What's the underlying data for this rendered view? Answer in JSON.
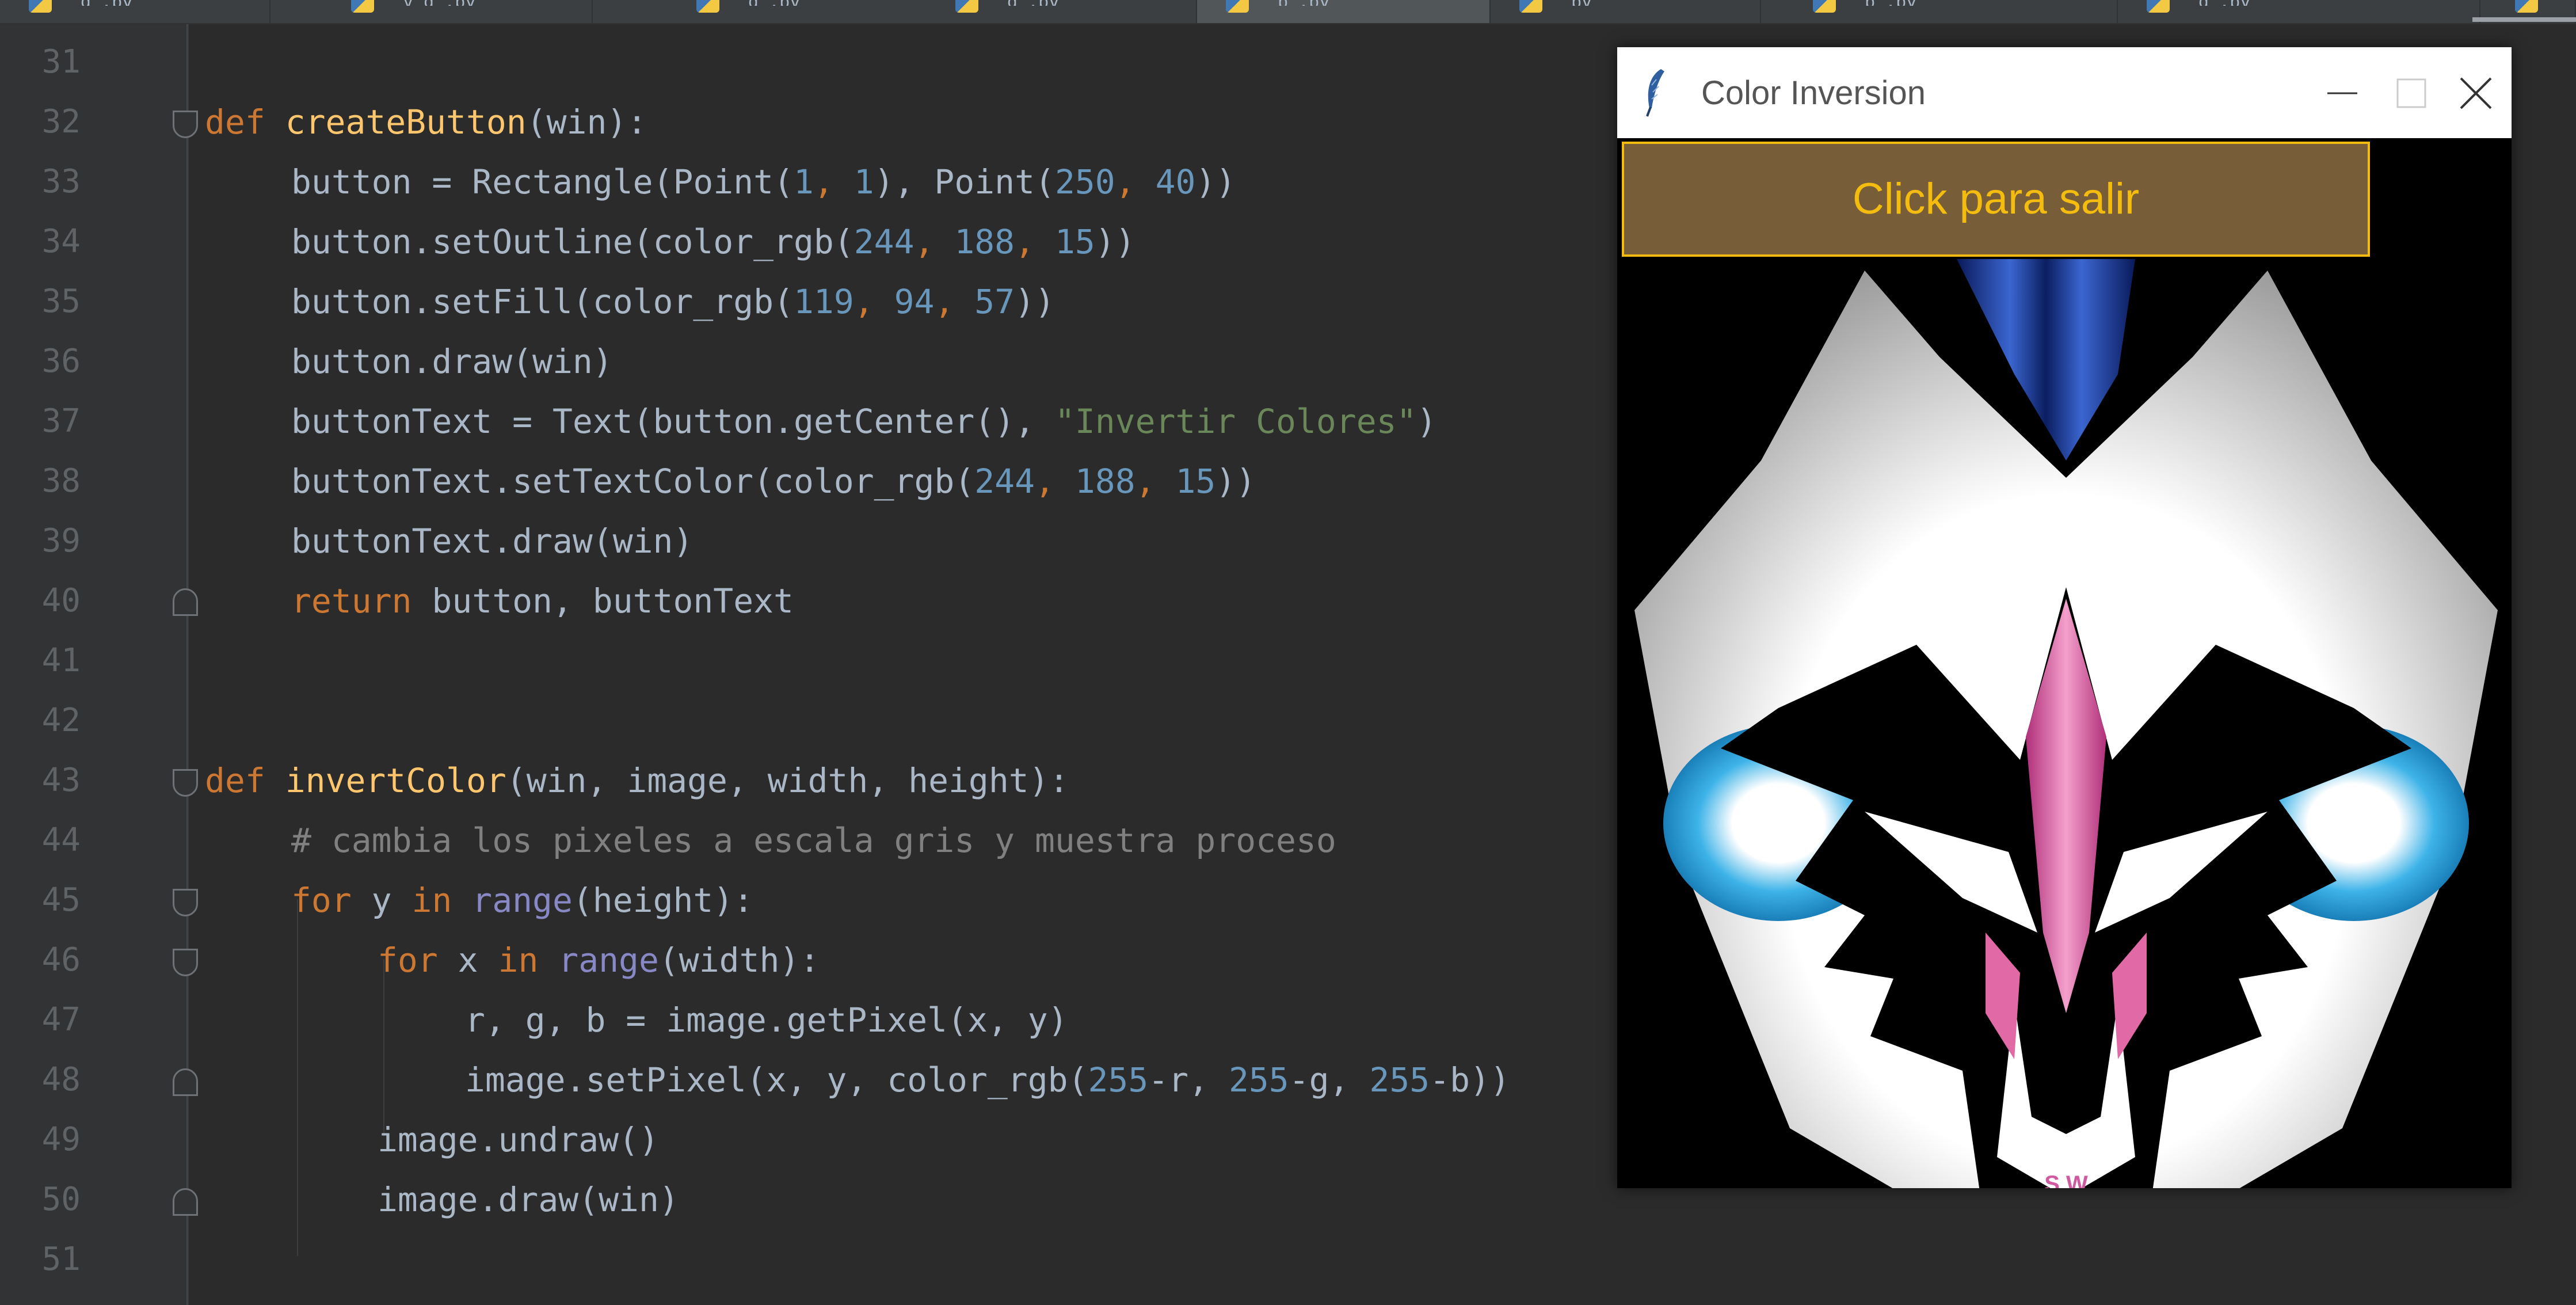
{
  "tabs": [
    {
      "label": "g .py"
    },
    {
      "label": "y g .py"
    },
    {
      "label": "g .py"
    },
    {
      "label": "g .py"
    },
    {
      "label": "p .py",
      "active": true
    },
    {
      "label": "py"
    },
    {
      "label": "p .py"
    },
    {
      "label": "g .py"
    }
  ],
  "line_numbers": [
    "31",
    "32",
    "33",
    "34",
    "35",
    "36",
    "37",
    "38",
    "39",
    "40",
    "41",
    "42",
    "43",
    "44",
    "45",
    "46",
    "47",
    "48",
    "49",
    "50",
    "51"
  ],
  "code": {
    "l32": {
      "kw": "def",
      "name": "createButton",
      "rest": "(win):"
    },
    "l33": {
      "a": "button = Rectangle(Point(",
      "n1": "1",
      "c1": ", ",
      "n2": "1",
      "b": "), Point(",
      "n3": "250",
      "c2": ", ",
      "n4": "40",
      "e": "))"
    },
    "l34": {
      "a": "button.setOutline(color_rgb(",
      "n1": "244",
      "c1": ", ",
      "n2": "188",
      "c2": ", ",
      "n3": "15",
      "e": "))"
    },
    "l35": {
      "a": "button.setFill(color_rgb(",
      "n1": "119",
      "c1": ", ",
      "n2": "94",
      "c2": ", ",
      "n3": "57",
      "e": "))"
    },
    "l36": "button.draw(win)",
    "l37": {
      "a": "buttonText = Text(button.getCenter(), ",
      "s": "\"Invertir Colores\"",
      "e": ")"
    },
    "l38": {
      "a": "buttonText.setTextColor(color_rgb(",
      "n1": "244",
      "c1": ", ",
      "n2": "188",
      "c2": ", ",
      "n3": "15",
      "e": "))"
    },
    "l39": "buttonText.draw(win)",
    "l40": {
      "kw": "return",
      "rest": " button, buttonText"
    },
    "l43": {
      "kw": "def",
      "name": "invertColor",
      "rest": "(win, image, width, height):"
    },
    "l44": "# cambia los pixeles a escala gris y muestra proceso",
    "l45": {
      "kw": "for",
      "v": " y ",
      "kw2": "in",
      "bi": " range",
      "rest": "(height):"
    },
    "l46": {
      "kw": "for",
      "v": " x ",
      "kw2": "in",
      "bi": " range",
      "rest": "(width):"
    },
    "l47": "r, g, b = image.getPixel(x, y)",
    "l48": {
      "a": "image.setPixel(x, y, color_rgb(",
      "n1": "255",
      "e1": "-r, ",
      "n2": "255",
      "e2": "-g, ",
      "n3": "255",
      "e3": "-b))"
    },
    "l49": "image.undraw()",
    "l50": "image.draw(win)"
  },
  "window": {
    "title": "Color Inversion",
    "exit_button_label": "Click para salir",
    "button_fill": "#775e39",
    "button_outline": "#f4bc0f",
    "logo_text": "S W"
  },
  "colors": {
    "keyword": "#cc7832",
    "function": "#ffc66d",
    "number": "#6897bb",
    "string": "#6a8759",
    "comment": "#808080"
  }
}
